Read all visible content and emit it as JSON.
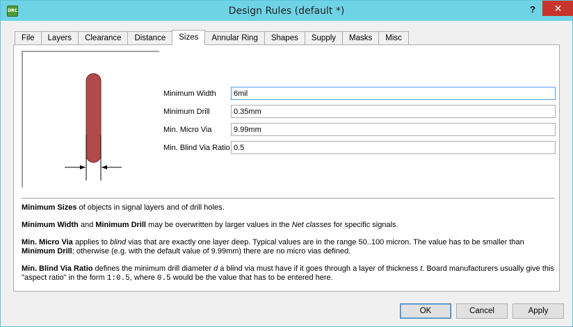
{
  "window": {
    "title": "Design Rules (default *)",
    "app_icon_text": "DRC",
    "help_glyph": "?",
    "close_glyph": "✕"
  },
  "tabs": [
    {
      "label": "File",
      "active": false
    },
    {
      "label": "Layers",
      "active": false
    },
    {
      "label": "Clearance",
      "active": false
    },
    {
      "label": "Distance",
      "active": false
    },
    {
      "label": "Sizes",
      "active": true
    },
    {
      "label": "Annular Ring",
      "active": false
    },
    {
      "label": "Shapes",
      "active": false
    },
    {
      "label": "Supply",
      "active": false
    },
    {
      "label": "Masks",
      "active": false
    },
    {
      "label": "Misc",
      "active": false
    }
  ],
  "fields": {
    "min_width": {
      "label": "Minimum Width",
      "value": "6mil"
    },
    "min_drill": {
      "label": "Minimum Drill",
      "value": "0.35mm"
    },
    "min_micro_via": {
      "label": "Min. Micro Via",
      "value": "9.99mm"
    },
    "min_blind_via_ratio": {
      "label": "Min. Blind Via Ratio",
      "value": "0.5"
    }
  },
  "help": {
    "p1": {
      "b1": "Minimum Sizes",
      "t1": " of objects in signal layers and of drill holes."
    },
    "p2": {
      "b1": "Minimum Width",
      "t1": " and ",
      "b2": "Minimum Drill",
      "t2": " may be overwritten by larger values in the ",
      "i1": "Net classes",
      "t3": " for specific signals."
    },
    "p3": {
      "b1": "Min. Micro Via",
      "t1": " applies to ",
      "i1": "blind",
      "t2": " vias that are exactly one layer deep. Typical values are in the range 50..100 micron. The value has to be smaller than ",
      "b2": "Minimum Drill",
      "t3": "; otherwise (e.g. with the default value of 9.99mm) there are no micro vias defined."
    },
    "p4": {
      "b1": "Min. Blind Via Ratio",
      "t1": " defines the minimum drill diameter ",
      "i1": "d",
      "t2": " a blind via must have if it goes through a layer of thickness ",
      "i2": "t",
      "t3": ". Board manufacturers usually give this \"aspect ratio\" in the form ",
      "m1": "1:0.5",
      "t4": ", where ",
      "m2": "0.5",
      "t5": " would be the value that has to be entered here."
    }
  },
  "buttons": {
    "ok": "OK",
    "cancel": "Cancel",
    "apply": "Apply"
  },
  "colors": {
    "trace": "#b14a4a",
    "titlebar": "#6fd3e6",
    "close": "#c7352c"
  }
}
